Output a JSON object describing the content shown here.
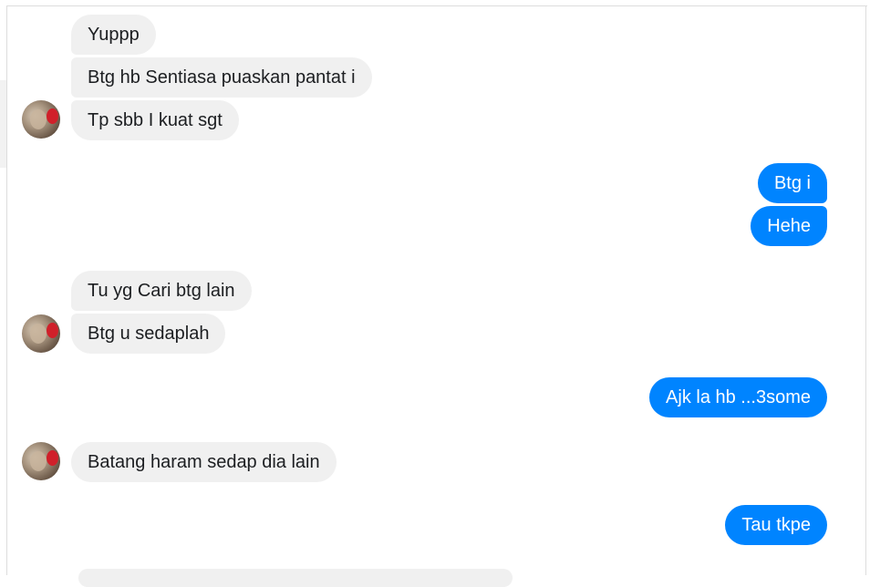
{
  "conversation": {
    "messages": [
      {
        "side": "in",
        "text": "Yuppp"
      },
      {
        "side": "in",
        "text": "Btg hb Sentiasa puaskan pantat i"
      },
      {
        "side": "in",
        "text": "Tp sbb I kuat sgt"
      },
      {
        "side": "out",
        "text": "Btg i"
      },
      {
        "side": "out",
        "text": "Hehe"
      },
      {
        "side": "in",
        "text": "Tu yg Cari btg lain"
      },
      {
        "side": "in",
        "text": "Btg u sedaplah"
      },
      {
        "side": "out",
        "text": "Ajk la hb ...3some"
      },
      {
        "side": "in",
        "text": "Batang haram sedap dia lain"
      },
      {
        "side": "out",
        "text": "Tau tkpe"
      }
    ]
  },
  "colors": {
    "incoming_bubble": "#f0f0f0",
    "outgoing_bubble": "#0084ff",
    "outgoing_text": "#ffffff",
    "incoming_text": "#1c1e21"
  }
}
